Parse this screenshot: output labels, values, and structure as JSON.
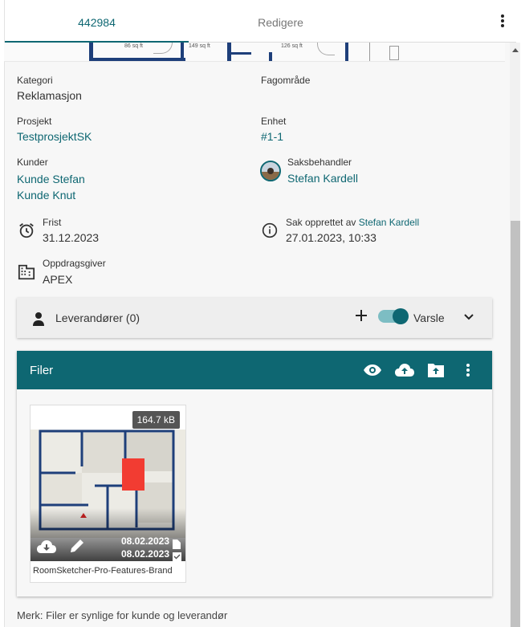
{
  "tabs": [
    {
      "label": "442984"
    },
    {
      "label": "Redigere"
    }
  ],
  "strip_labels": [
    "86 sq ft",
    "149 sq ft",
    "126 sq ft"
  ],
  "fields": {
    "kategori": {
      "label": "Kategori",
      "value": "Reklamasjon"
    },
    "fagomrade": {
      "label": "Fagområde",
      "value": ""
    },
    "prosjekt": {
      "label": "Prosjekt",
      "value": "TestprosjektSK"
    },
    "enhet": {
      "label": "Enhet",
      "value": "#1-1"
    },
    "kunder": {
      "label": "Kunder",
      "values": [
        "Kunde Stefan",
        "Kunde Knut"
      ]
    },
    "saksbehandler": {
      "label": "Saksbehandler",
      "value": "Stefan Kardell"
    },
    "frist": {
      "label": "Frist",
      "value": "31.12.2023"
    },
    "opprettet": {
      "label": "Sak opprettet av",
      "by": "Stefan Kardell",
      "value": "27.01.2023, 10:33"
    },
    "oppdragsgiver": {
      "label": "Oppdragsgiver",
      "value": "APEX"
    }
  },
  "suppliers": {
    "title": "Leverandører (0)",
    "notify_label": "Varsle",
    "notify_on": true
  },
  "files": {
    "title": "Filer",
    "items": [
      {
        "name": "RoomSketcher-Pro-Features-Brand",
        "size": "164.7 kB",
        "date1": "08.02.2023",
        "date2": "08.02.2023"
      }
    ]
  },
  "note": "Merk: Filer er synlige for kunde og leverandør",
  "colors": {
    "accent": "#0e6772",
    "header": "#0e6772"
  },
  "icons": [
    "more-vert-icon",
    "alarm-clock-icon",
    "info-icon",
    "building-icon",
    "person-icon",
    "add-icon",
    "chevron-down-icon",
    "eye-icon",
    "cloud-upload-icon",
    "folder-upload-icon",
    "download-icon",
    "edit-icon",
    "file-icon",
    "checkbox-icon"
  ]
}
